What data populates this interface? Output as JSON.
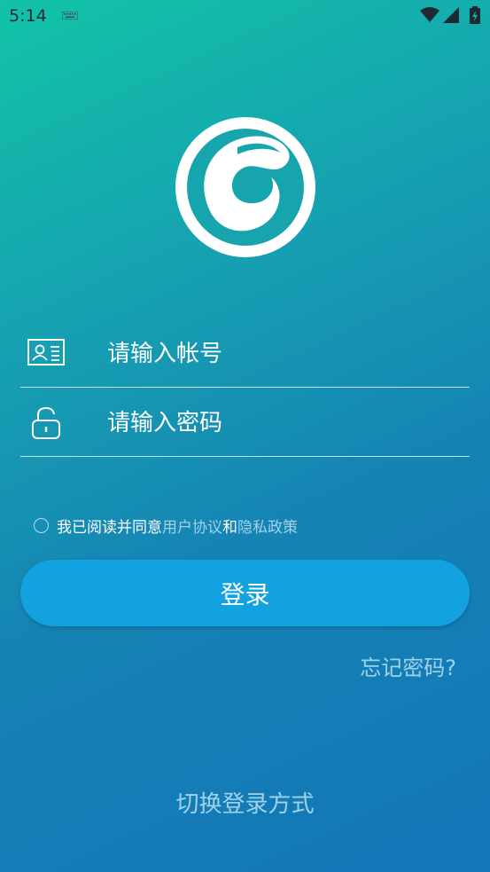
{
  "status_bar": {
    "time": "5:14",
    "icons": [
      "keyboard-icon",
      "wifi-icon",
      "signal-icon",
      "battery-icon"
    ]
  },
  "logo": {
    "name": "app-logo"
  },
  "form": {
    "account_placeholder": "请输入帐号",
    "password_placeholder": "请输入密码",
    "account_icon": "id-card-icon",
    "password_icon": "lock-icon"
  },
  "agreement": {
    "prefix": "我已阅读并同意",
    "user_agreement": "用户协议",
    "and": "和",
    "privacy_policy": "隐私政策",
    "checked": false
  },
  "login_button": "登录",
  "forgot_password": "忘记密码?",
  "switch_login": "切换登录方式",
  "colors": {
    "gradient_start": "#12c3a6",
    "gradient_end": "#1475b8",
    "button": "#12a2df",
    "link": "#9fd3ea"
  }
}
